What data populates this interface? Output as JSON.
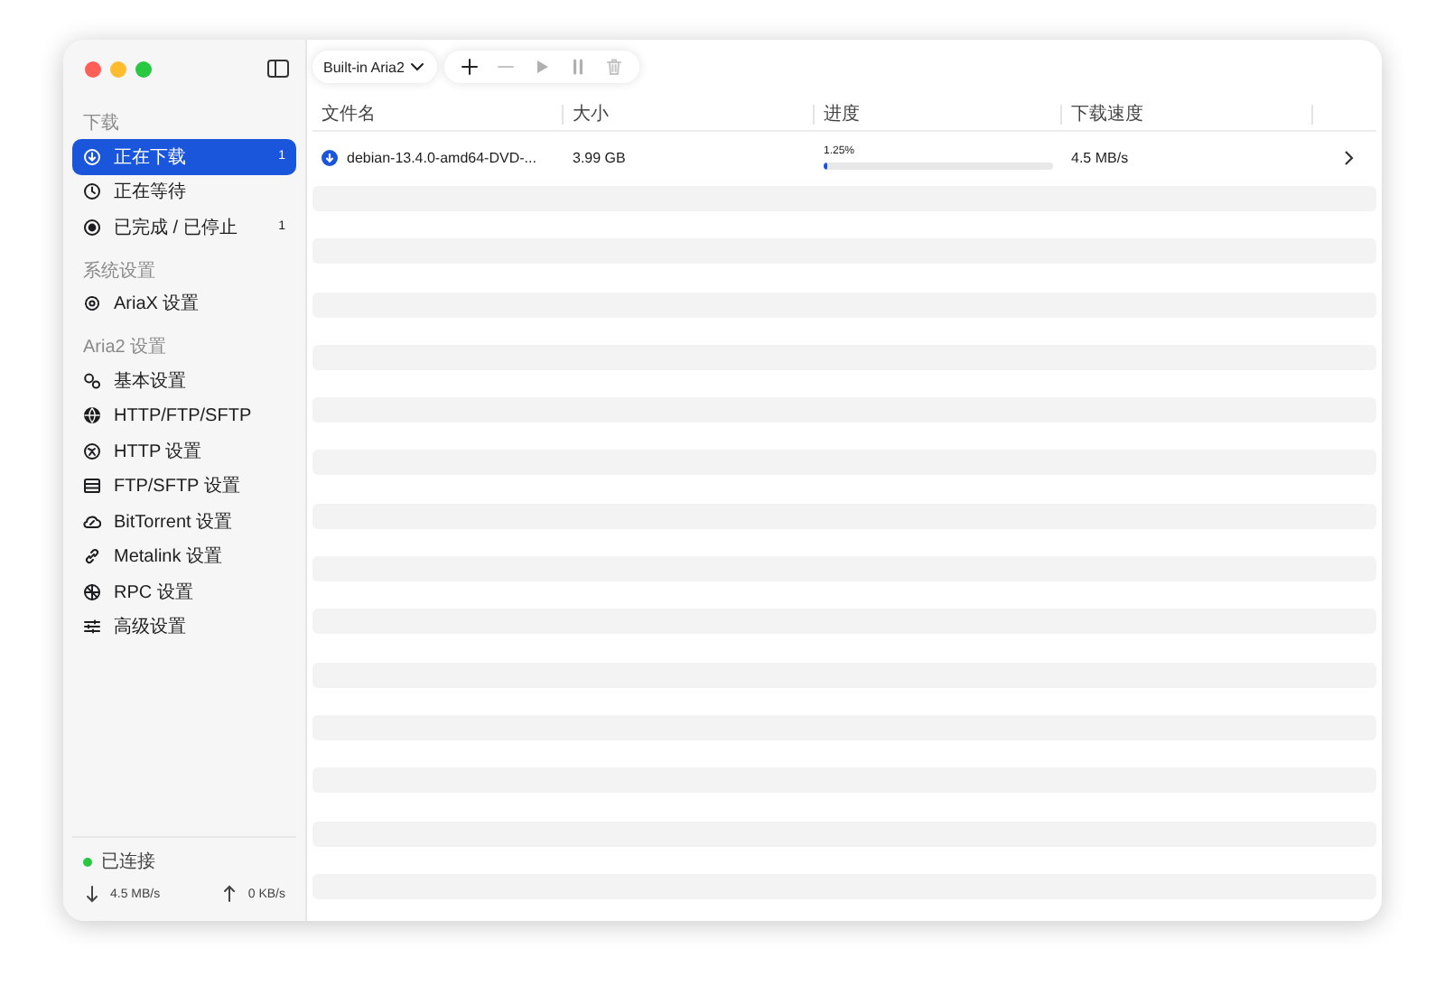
{
  "sidebar": {
    "sections": [
      {
        "title": "下载",
        "items": [
          {
            "label": "正在下载",
            "count": "1",
            "selected": true
          },
          {
            "label": "正在等待",
            "selected": false
          },
          {
            "label": "已完成 / 已停止",
            "count": "1",
            "selected": false
          }
        ]
      },
      {
        "title": "系统设置",
        "items": [
          {
            "label": "AriaX 设置",
            "selected": false
          }
        ]
      },
      {
        "title": "Aria2 设置",
        "items": [
          {
            "label": "基本设置",
            "selected": false
          },
          {
            "label": "HTTP/FTP/SFTP",
            "selected": false
          },
          {
            "label": "HTTP 设置",
            "selected": false
          },
          {
            "label": "FTP/SFTP 设置",
            "selected": false
          },
          {
            "label": "BitTorrent 设置",
            "selected": false
          },
          {
            "label": "Metalink 设置",
            "selected": false
          },
          {
            "label": "RPC 设置",
            "selected": false
          },
          {
            "label": "高级设置",
            "selected": false
          }
        ]
      }
    ],
    "status": {
      "label": "已连接",
      "connected": true,
      "download": "4.5 MB/s",
      "upload": "0 KB/s"
    }
  },
  "toolbar": {
    "server": "Built-in Aria2",
    "actions": [
      {
        "kind": "add",
        "disabled": false
      },
      {
        "kind": "remove",
        "disabled": true
      },
      {
        "kind": "start",
        "disabled": true
      },
      {
        "kind": "pause",
        "disabled": true
      },
      {
        "kind": "delete",
        "disabled": true
      }
    ]
  },
  "table": {
    "columns": [
      "文件名",
      "大小",
      "进度",
      "下载速度"
    ],
    "rows": [
      {
        "name": "debian-13.4.0-amd64-DVD-...",
        "size": "3.99 GB",
        "progress": "1.25%",
        "level": 0.0125,
        "speed": "4.5 MB/s"
      }
    ]
  }
}
